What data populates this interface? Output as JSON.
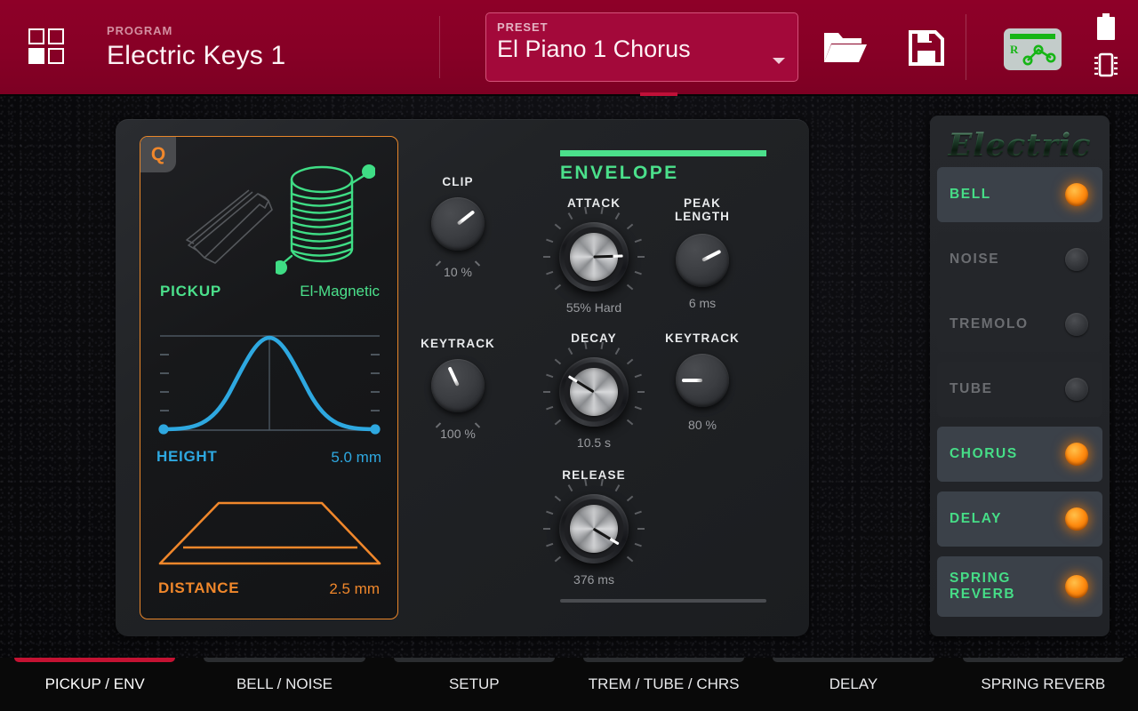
{
  "header": {
    "program_label": "PROGRAM",
    "program_name": "Electric Keys 1",
    "preset_label": "PRESET",
    "preset_value": "El Piano 1 Chorus",
    "icons": {
      "apps": "grid-icon",
      "load": "folder-open-icon",
      "save": "floppy-disk-icon",
      "routing": "routing-matrix-icon",
      "routing_letter": "R",
      "battery": "battery-icon",
      "chip": "chip-icon"
    },
    "colors": {
      "bar": "#8e0028",
      "preset_box": "#a3093a",
      "preset_border": "#d4537a"
    }
  },
  "pickup": {
    "badge": "Q",
    "label": "PICKUP",
    "type": "El-Magnetic",
    "height_label": "HEIGHT",
    "height_value": "5.0 mm",
    "distance_label": "DISTANCE",
    "distance_value": "2.5 mm",
    "colors": {
      "pickup": "#4be08b",
      "height": "#2ea8e0",
      "distance": "#f0872b",
      "border": "#e8862a"
    }
  },
  "knobs_left": [
    {
      "name": "CLIP",
      "value": "10 %",
      "angle": 232
    },
    {
      "name": "KEYTRACK",
      "value": "100 %",
      "angle": 155
    }
  ],
  "envelope": {
    "title": "ENVELOPE",
    "accent": "#4be08b",
    "knobs": [
      {
        "name": "ATTACK",
        "value": "55% Hard",
        "angle": 268,
        "size": "big"
      },
      {
        "name": "PEAK LENGTH",
        "value": "6 ms",
        "angle": 243,
        "size": "small"
      },
      {
        "name": "DECAY",
        "value": "10.5 s",
        "angle": 122,
        "size": "big"
      },
      {
        "name": "KEYTRACK",
        "value": "80 %",
        "angle": 90,
        "size": "small"
      },
      {
        "name": "RELEASE",
        "value": "376 ms",
        "angle": 301,
        "size": "big"
      }
    ]
  },
  "rack": {
    "logo": "Electric",
    "modules": [
      {
        "name": "BELL",
        "active": true
      },
      {
        "name": "NOISE",
        "active": false
      },
      {
        "name": "TREMOLO",
        "active": false
      },
      {
        "name": "TUBE",
        "active": false
      },
      {
        "name": "CHORUS",
        "active": true
      },
      {
        "name": "DELAY",
        "active": true
      },
      {
        "name": "SPRING REVERB",
        "active": true
      }
    ],
    "led_on_color": "#ff8c10",
    "text_on_color": "#46dd87"
  },
  "tabs": [
    {
      "label": "PICKUP / ENV",
      "active": true
    },
    {
      "label": "BELL / NOISE",
      "active": false
    },
    {
      "label": "SETUP",
      "active": false
    },
    {
      "label": "TREM / TUBE / CHRS",
      "active": false
    },
    {
      "label": "DELAY",
      "active": false
    },
    {
      "label": "SPRING REVERB",
      "active": false
    }
  ]
}
